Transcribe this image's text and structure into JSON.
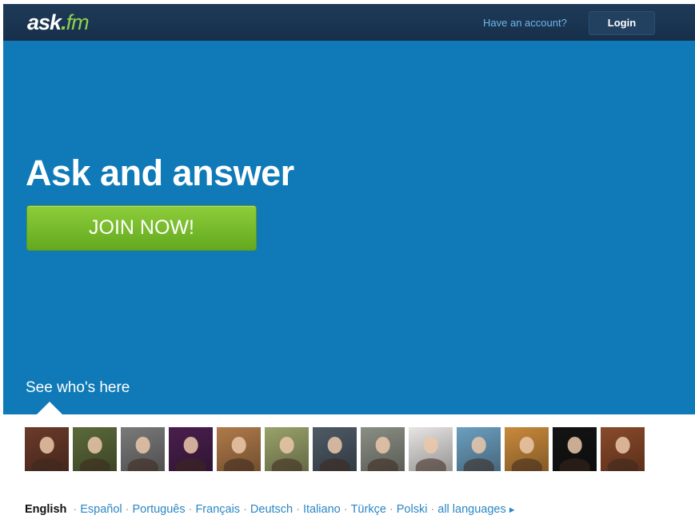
{
  "header": {
    "logo_main": "ask",
    "logo_dot": ".",
    "logo_suffix": "fm",
    "have_account": "Have an account?",
    "login_label": "Login"
  },
  "hero": {
    "headline": "Ask and answer",
    "join_label": "JOIN NOW!",
    "see_who": "See who's here"
  },
  "avatars": [
    {
      "bg": "#6b3b2a"
    },
    {
      "bg": "#5c6a3a"
    },
    {
      "bg": "#7a7a7a"
    },
    {
      "bg": "#4a1f4e"
    },
    {
      "bg": "#b07a4a"
    },
    {
      "bg": "#9aa26a"
    },
    {
      "bg": "#4e5a66"
    },
    {
      "bg": "#8a8f85"
    },
    {
      "bg": "#e8e4e4"
    },
    {
      "bg": "#6c9fc0"
    },
    {
      "bg": "#c98a3c"
    },
    {
      "bg": "#141414"
    },
    {
      "bg": "#8a4a2a"
    }
  ],
  "languages": {
    "current": "English",
    "options": [
      "Español",
      "Português",
      "Français",
      "Deutsch",
      "Italiano",
      "Türkçe",
      "Polski",
      "all languages"
    ]
  },
  "colors": {
    "topbar": "#1a3552",
    "hero": "#0f7ab7",
    "join_button": "#75bb2b",
    "link": "#2b86c5"
  }
}
